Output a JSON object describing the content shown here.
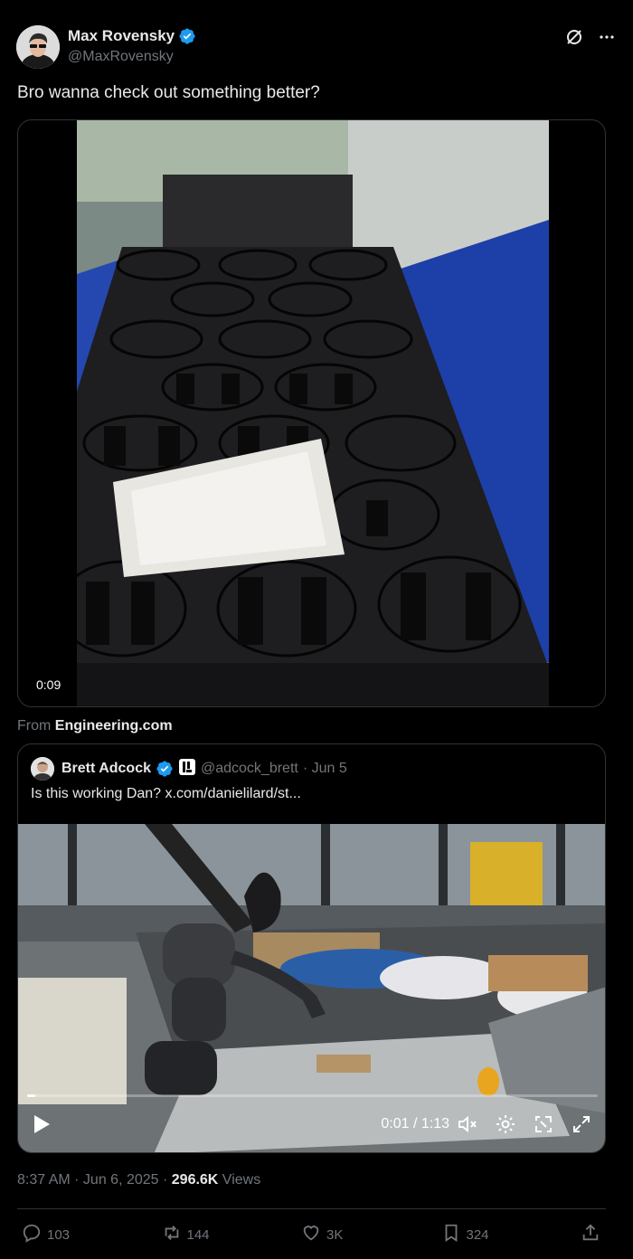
{
  "author": {
    "name": "Max Rovensky",
    "handle": "@MaxRovensky"
  },
  "tweet": {
    "text": "Bro wanna check out something better?",
    "video_duration": "0:09",
    "source_prefix": "From",
    "source_name": "Engineering.com"
  },
  "quote": {
    "name": "Brett Adcock",
    "handle": "@adcock_brett",
    "date": "· Jun 5",
    "text": "Is this working Dan?  x.com/danielilard/st...",
    "video_time": "0:01 / 1:13",
    "video_progress": 0.015
  },
  "meta": {
    "time": "8:37 AM · Jun 6, 2025 · ",
    "views_count": "296.6K",
    "views_label": " Views"
  },
  "actions": {
    "replies": "103",
    "reposts": "144",
    "likes": "3K",
    "bookmarks": "324"
  },
  "colors": {
    "background": "#000000",
    "text": "#e7e9ea",
    "muted": "#71767b",
    "verified": "#1d9bf0",
    "border": "#2f3336"
  }
}
